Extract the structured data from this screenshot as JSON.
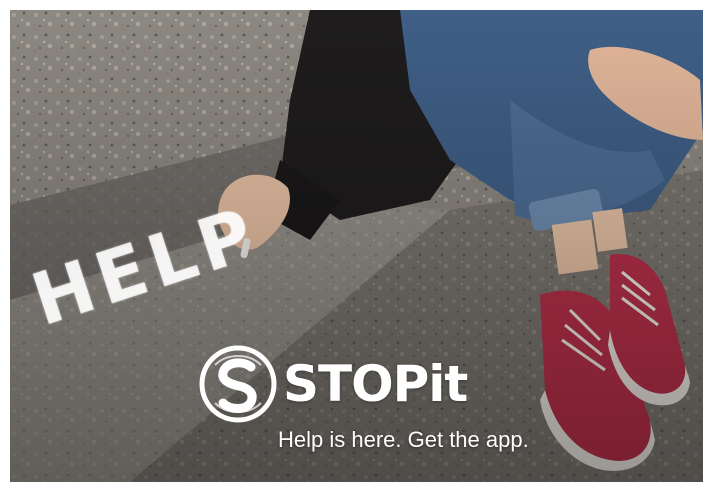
{
  "ad": {
    "chalk_text": "HELP",
    "brand_name": "STOPit",
    "tagline": "Help is here. Get the app."
  },
  "colors": {
    "brand_text": "#ffffff",
    "step_stone": "#8a8680",
    "jeans": "#3f5f86",
    "sneaker_red": "#b8304a"
  },
  "icons": {
    "logo": "stopit-s-circle-logo"
  }
}
